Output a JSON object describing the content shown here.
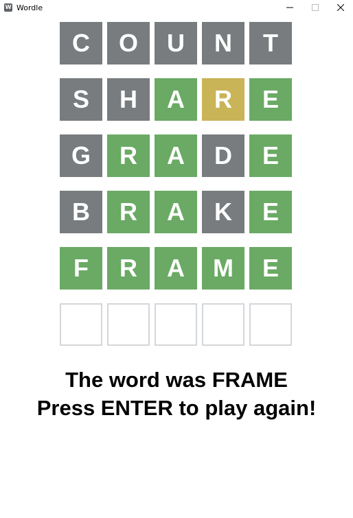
{
  "window": {
    "title": "Wordle",
    "icon_letter": "W",
    "icon": "app-icon",
    "controls": [
      "minimize-icon",
      "maximize-icon",
      "close-icon"
    ]
  },
  "colors": {
    "absent": "#787c7e",
    "correct": "#6aaa64",
    "present": "#c9b458",
    "empty_border": "#d3d6da"
  },
  "board": {
    "rows": [
      {
        "tiles": [
          {
            "letter": "C",
            "state": "absent"
          },
          {
            "letter": "O",
            "state": "absent"
          },
          {
            "letter": "U",
            "state": "absent"
          },
          {
            "letter": "N",
            "state": "absent"
          },
          {
            "letter": "T",
            "state": "absent"
          }
        ]
      },
      {
        "tiles": [
          {
            "letter": "S",
            "state": "absent"
          },
          {
            "letter": "H",
            "state": "absent"
          },
          {
            "letter": "A",
            "state": "correct"
          },
          {
            "letter": "R",
            "state": "present"
          },
          {
            "letter": "E",
            "state": "correct"
          }
        ]
      },
      {
        "tiles": [
          {
            "letter": "G",
            "state": "absent"
          },
          {
            "letter": "R",
            "state": "correct"
          },
          {
            "letter": "A",
            "state": "correct"
          },
          {
            "letter": "D",
            "state": "absent"
          },
          {
            "letter": "E",
            "state": "correct"
          }
        ]
      },
      {
        "tiles": [
          {
            "letter": "B",
            "state": "absent"
          },
          {
            "letter": "R",
            "state": "correct"
          },
          {
            "letter": "A",
            "state": "correct"
          },
          {
            "letter": "K",
            "state": "absent"
          },
          {
            "letter": "E",
            "state": "correct"
          }
        ]
      },
      {
        "tiles": [
          {
            "letter": "F",
            "state": "correct"
          },
          {
            "letter": "R",
            "state": "correct"
          },
          {
            "letter": "A",
            "state": "correct"
          },
          {
            "letter": "M",
            "state": "correct"
          },
          {
            "letter": "E",
            "state": "correct"
          }
        ]
      },
      {
        "tiles": [
          {
            "letter": "",
            "state": "empty"
          },
          {
            "letter": "",
            "state": "empty"
          },
          {
            "letter": "",
            "state": "empty"
          },
          {
            "letter": "",
            "state": "empty"
          },
          {
            "letter": "",
            "state": "empty"
          }
        ]
      }
    ]
  },
  "message": {
    "line1": "The word was FRAME",
    "line2": "Press ENTER to play again!"
  }
}
